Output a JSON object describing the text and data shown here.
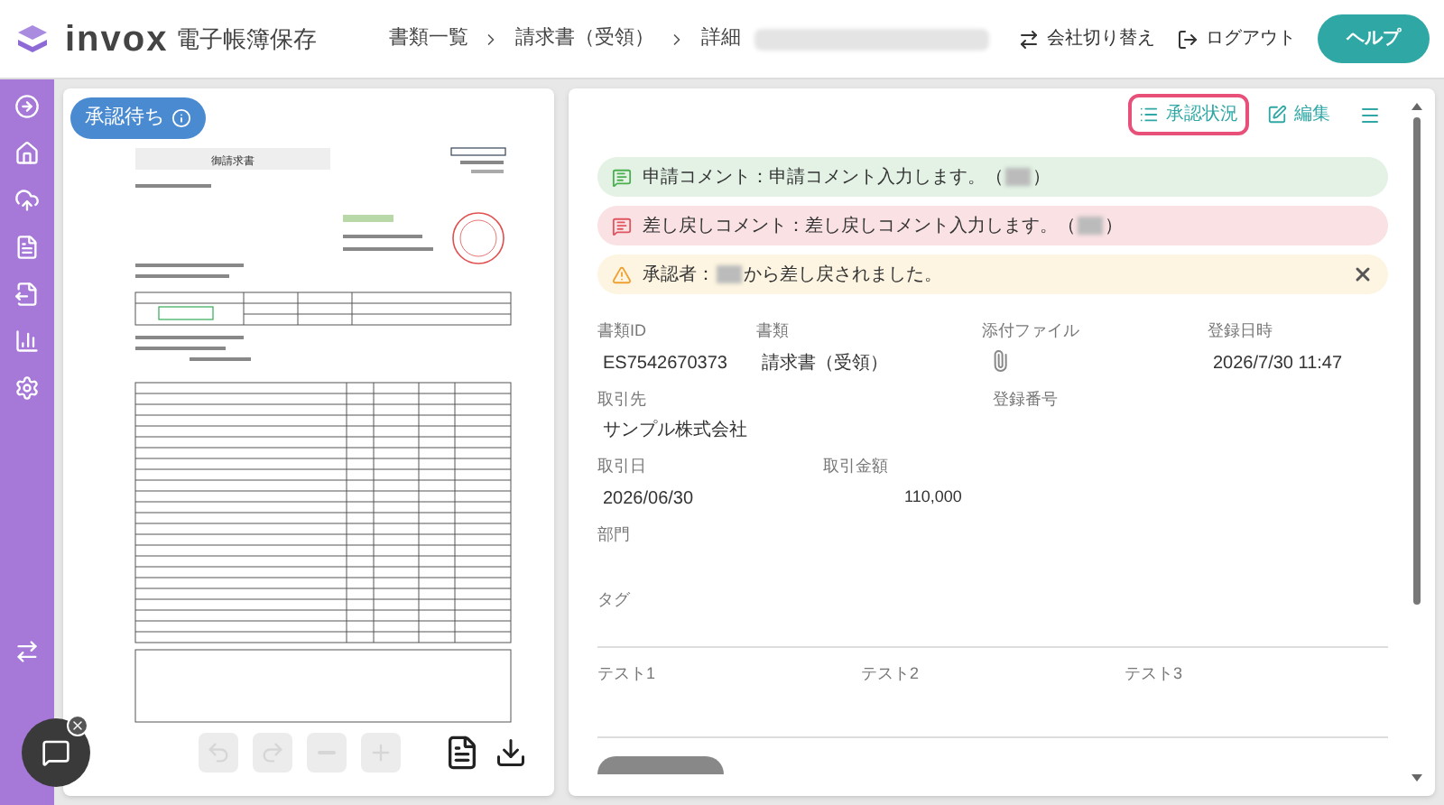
{
  "header": {
    "brand": "invox",
    "product": "電子帳簿保存",
    "breadcrumb": [
      "書類一覧",
      "請求書（受領）",
      "詳細"
    ],
    "switch_company": "会社切り替え",
    "logout": "ログアウト",
    "help": "ヘルプ"
  },
  "viewer": {
    "status": "承認待ち",
    "invoice_title": "御請求書",
    "tools": [
      {
        "disabled": true
      },
      {
        "disabled": true
      },
      {
        "disabled": true
      },
      {
        "disabled": true
      }
    ]
  },
  "toolbar": [
    {
      "label": "承認状況",
      "selected": true
    },
    {
      "label": "編集",
      "selected": false
    }
  ],
  "alerts": [
    {
      "kind": "request",
      "parts": [
        {
          "text": "申請コメント：申請コメント入力します。（"
        },
        {
          "redacted": true
        },
        {
          "text": "）"
        }
      ],
      "dismissible": false
    },
    {
      "kind": "return",
      "parts": [
        {
          "text": "差し戻しコメント：差し戻しコメント入力します。（"
        },
        {
          "redacted": true
        },
        {
          "text": "）"
        }
      ],
      "dismissible": false
    },
    {
      "kind": "warning",
      "parts": [
        {
          "text": "承認者："
        },
        {
          "redacted": true
        },
        {
          "text": "から差し戻されました。"
        }
      ],
      "dismissible": true
    }
  ],
  "fields": [
    [
      {
        "label": "書類ID",
        "value": "ES7542670373"
      },
      {
        "label": "書類",
        "value": "請求書（受領）"
      },
      {
        "label": "添付ファイル",
        "kind": "attachment"
      },
      {
        "label": "登録日時",
        "value": "2026/7/30 11:47"
      }
    ],
    [
      {
        "label": "取引先",
        "value": "サンプル株式会社"
      },
      {
        "label": "登録番号"
      }
    ],
    [
      {
        "label": "取引日",
        "value": "2026/06/30"
      },
      {
        "label": "取引金額",
        "value": "110,000",
        "kind": "amount"
      }
    ],
    [
      {
        "label": "部門"
      }
    ],
    [
      {
        "label": "タグ"
      }
    ]
  ],
  "custom_fields": [
    "テスト1",
    "テスト2",
    "テスト3"
  ]
}
